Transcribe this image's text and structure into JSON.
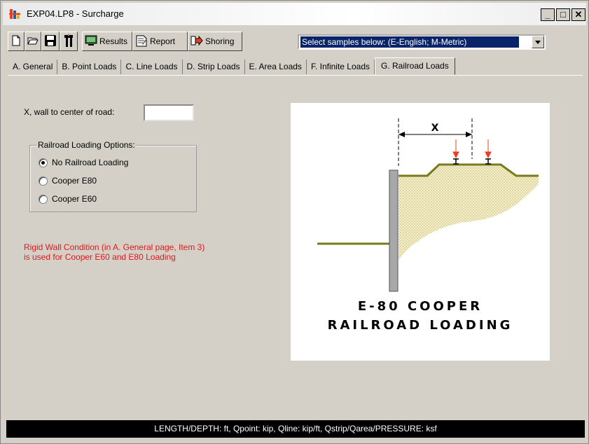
{
  "window": {
    "title": "EXP04.LP8 - Surcharge",
    "controls": {
      "minimize": "_",
      "maximize": "□",
      "close": "✕"
    }
  },
  "toolbar": {
    "new_icon": "new-file-icon",
    "open_icon": "open-folder-icon",
    "save_icon": "save-disk-icon",
    "tool_icon": "sheet-pile-icon",
    "results_label": "Results",
    "report_label": "Report",
    "shoring_label": "Shoring",
    "samples_select_value": "Select samples below:  (E-English; M-Metric)"
  },
  "tabs": [
    {
      "label": "A. General"
    },
    {
      "label": "B. Point Loads"
    },
    {
      "label": "C. Line Loads"
    },
    {
      "label": "D. Strip Loads"
    },
    {
      "label": "E. Area Loads"
    },
    {
      "label": "F. Infinite Loads"
    },
    {
      "label": "G. Railroad Loads",
      "active": true
    }
  ],
  "railroad": {
    "x_label": "X, wall to center of road:",
    "x_value": "",
    "options_title": "Railroad Loading Options:",
    "options": [
      {
        "label": "No Railroad Loading",
        "selected": true
      },
      {
        "label": "Cooper E80",
        "selected": false
      },
      {
        "label": "Cooper E60",
        "selected": false
      }
    ],
    "note_line1": "Rigid Wall Condition (in A. General page, Item 3)",
    "note_line2": "is used for Cooper E60 and E80 Loading"
  },
  "diagram": {
    "dimension_label": "X",
    "caption_line1": "E-80 COOPER",
    "caption_line2": "RAILROAD LOADING",
    "colors": {
      "ground": "#7a7a1a",
      "soil": "#e8e2b0",
      "wall": "#a8a8a8",
      "load_arrow": "#e8401c"
    }
  },
  "statusbar": {
    "text": "LENGTH/DEPTH: ft, Qpoint: kip, Qline: kip/ft, Qstrip/Qarea/PRESSURE: ksf"
  }
}
